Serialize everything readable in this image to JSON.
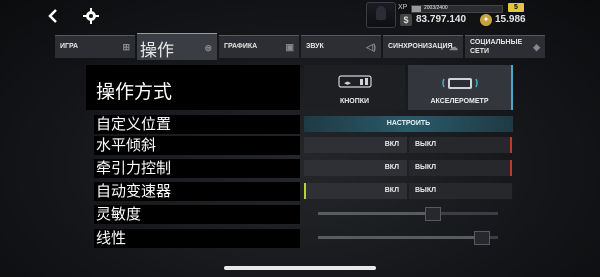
{
  "topbar": {
    "back_icon": "chevron-left-icon",
    "settings_icon": "gear-icon",
    "xp_label": "XP",
    "xp_progress_text": "2003/2400",
    "xp_progress": 0.1,
    "level": "5",
    "money": "83.797.140",
    "gold": "15.986"
  },
  "tabs": [
    {
      "label": "ИГРА",
      "icon": "gamepad-icon"
    },
    {
      "label": "操作",
      "icon": "steering-icon"
    },
    {
      "label": "ГРАФИКА",
      "icon": "image-icon"
    },
    {
      "label": "ЗВУК",
      "icon": "speaker-icon"
    },
    {
      "label": "СИНХРОНИЗАЦИЯ",
      "icon": "cloud-icon"
    },
    {
      "label": "СОЦИАЛЬНЫЕ СЕТИ",
      "icon": "share-icon"
    }
  ],
  "settings": {
    "control_mode": {
      "label": "操作方式",
      "options": [
        "КНОПКИ",
        "АКСЕЛЕРОМЕТР"
      ],
      "selected": "АКСЕЛЕРОМЕТР"
    },
    "custom_position": {
      "label": "自定义位置",
      "button": "НАСТРОИТЬ"
    },
    "horizontal_tilt": {
      "label": "水平倾斜",
      "on": "ВКЛ",
      "off": "ВЫКЛ"
    },
    "traction_control": {
      "label": "牵引力控制",
      "on": "ВКЛ",
      "off": "ВЫКЛ"
    },
    "auto_transmission": {
      "label": "自动变速器",
      "on": "ВКЛ",
      "off": "ВЫКЛ"
    },
    "sensitivity": {
      "label": "灵敏度",
      "value": 0.65
    },
    "linearity": {
      "label": "线性",
      "value": 0.95
    }
  },
  "colors": {
    "accent": "#4aa8c8",
    "off_marker": "#c03a2a",
    "on_marker": "#b6d23a",
    "level_badge": "#e7c53a"
  }
}
